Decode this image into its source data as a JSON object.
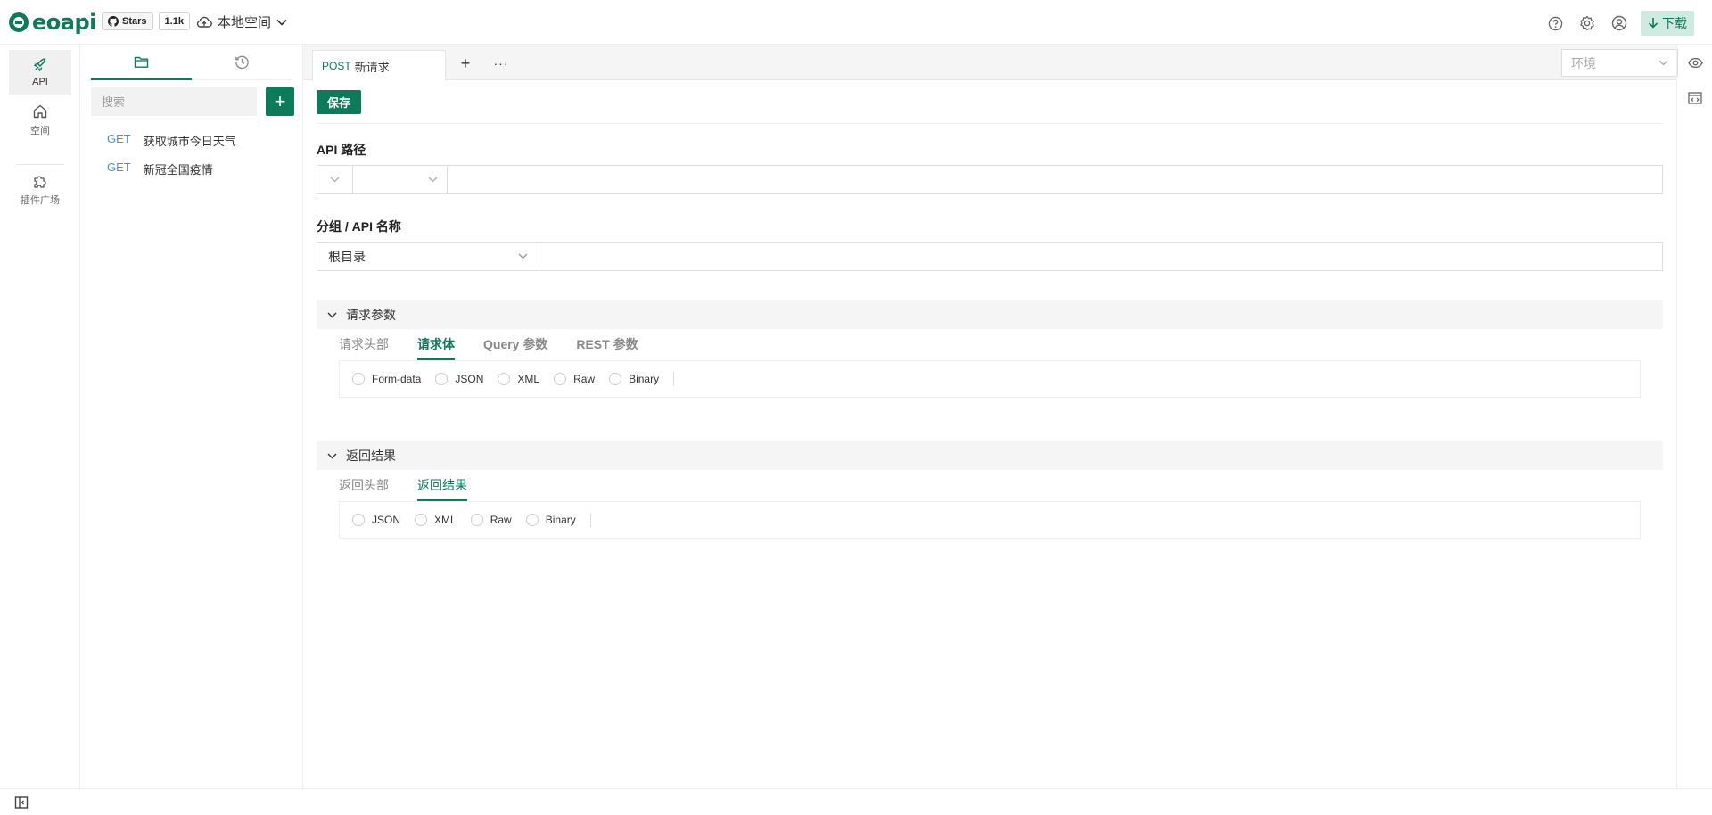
{
  "app": {
    "brand": "eoapi"
  },
  "github": {
    "stars_label": "Stars",
    "stars_count": "1.1k"
  },
  "workspace": {
    "name": "本地空间"
  },
  "topbar": {
    "download_label": "下载"
  },
  "rail": {
    "items": [
      {
        "label": "API",
        "icon": "rocket-icon"
      },
      {
        "label": "空间",
        "icon": "home-icon"
      },
      {
        "label": "插件广场",
        "icon": "puzzle-icon"
      }
    ]
  },
  "sidebar": {
    "tabs": [
      {
        "icon": "folder-icon"
      },
      {
        "icon": "history-icon"
      }
    ],
    "search": {
      "placeholder": "搜索",
      "value": ""
    },
    "apis": [
      {
        "method": "GET",
        "name": "获取城市今日天气"
      },
      {
        "method": "GET",
        "name": "新冠全国疫情"
      }
    ]
  },
  "tabbar": {
    "tab": {
      "method": "POST",
      "title": "新请求"
    },
    "more": "···",
    "env": {
      "placeholder": "环境"
    }
  },
  "editor": {
    "save_label": "保存",
    "path_label": "API 路径",
    "group_label": "分组 / API 名称",
    "group_value": "根目录"
  },
  "request": {
    "title": "请求参数",
    "tabs": [
      "请求头部",
      "请求体",
      "Query 参数",
      "REST 参数"
    ],
    "active_tab": 1,
    "body_types": [
      "Form-data",
      "JSON",
      "XML",
      "Raw",
      "Binary"
    ]
  },
  "response": {
    "title": "返回结果",
    "tabs": [
      "返回头部",
      "返回结果"
    ],
    "active_tab": 1,
    "body_types": [
      "JSON",
      "XML",
      "Raw",
      "Binary"
    ]
  },
  "colors": {
    "accent": "#0d7a5a",
    "method_get": "#4a90e2"
  }
}
